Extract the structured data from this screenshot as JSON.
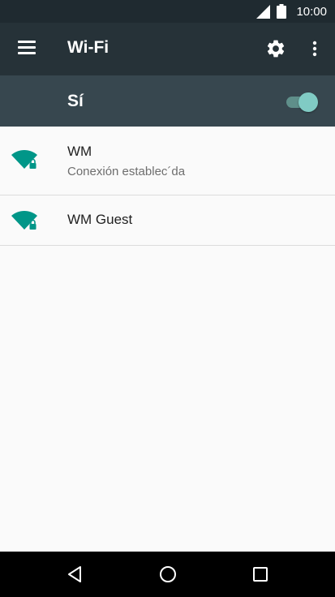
{
  "status_bar": {
    "time": "10:00",
    "icons": [
      "signal-icon",
      "battery-icon"
    ]
  },
  "app_bar": {
    "title": "Wi-Fi",
    "icons": [
      "menu-icon",
      "settings-icon",
      "more-options-icon"
    ]
  },
  "toggle": {
    "label": "Sí",
    "state": "on",
    "accent_color": "#80cbc4"
  },
  "networks": [
    {
      "name": "WM",
      "status": "Conexión establec´da",
      "icon": "wifi-locked-icon"
    },
    {
      "name": "WM Guest",
      "status": "",
      "icon": "wifi-locked-icon"
    }
  ],
  "nav_bar": {
    "icons": [
      "back-icon",
      "home-icon",
      "recent-apps-icon"
    ]
  },
  "colors": {
    "status_bar": "#1f2a30",
    "app_bar": "#263238",
    "toggle_bar": "#37474f",
    "wifi_icon": "#009688",
    "background": "#fafafa"
  }
}
